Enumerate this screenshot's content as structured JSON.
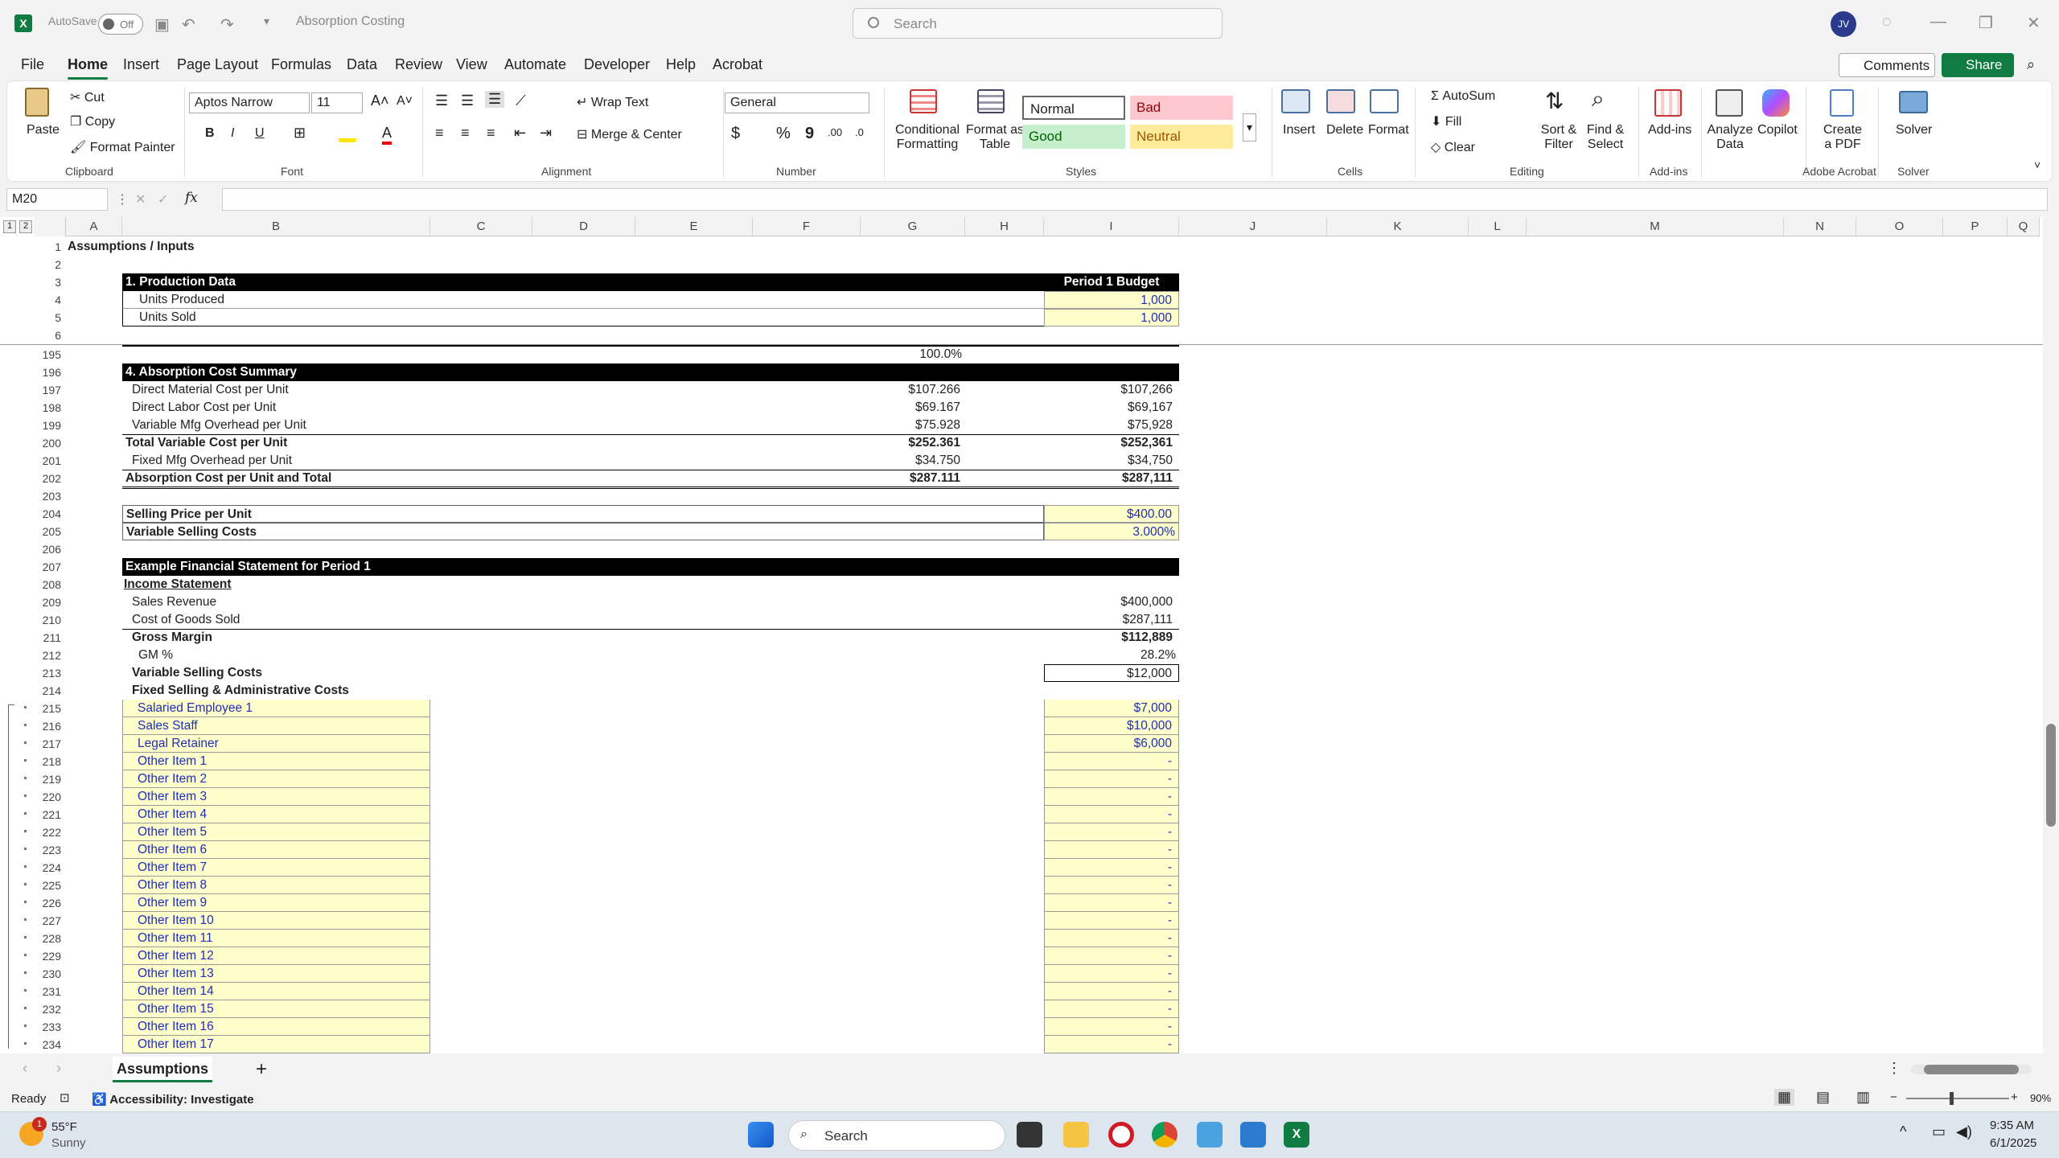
{
  "titlebar": {
    "autosave_label": "AutoSave",
    "autosave_state": "Off",
    "doc_title": "Absorption Costing",
    "search_placeholder": "Search",
    "avatar_initials": "JV"
  },
  "menu": {
    "items": [
      "File",
      "Home",
      "Insert",
      "Page Layout",
      "Formulas",
      "Data",
      "Review",
      "View",
      "Automate",
      "Developer",
      "Help",
      "Acrobat"
    ],
    "active": "Home",
    "comments_label": "Comments",
    "share_label": "Share"
  },
  "ribbon": {
    "clipboard": {
      "paste": "Paste",
      "cut": "Cut",
      "copy": "Copy",
      "format_painter": "Format Painter",
      "group": "Clipboard"
    },
    "font": {
      "name": "Aptos Narrow",
      "size": "11",
      "group": "Font",
      "bold": "B",
      "italic": "I",
      "underline": "U"
    },
    "alignment": {
      "wrap_text": "Wrap Text",
      "merge_center": "Merge & Center",
      "group": "Alignment"
    },
    "number": {
      "format": "General",
      "currency": "$",
      "percent": "%",
      "comma": "9",
      "group": "Number"
    },
    "styles": {
      "conditional": "Conditional",
      "conditional2": "Formatting",
      "format_table": "Format as",
      "format_table2": "Table",
      "normal": "Normal",
      "bad": "Bad",
      "good": "Good",
      "neutral": "Neutral",
      "group": "Styles"
    },
    "cells": {
      "insert": "Insert",
      "delete": "Delete",
      "format": "Format",
      "group": "Cells"
    },
    "editing": {
      "autosum": "AutoSum",
      "fill": "Fill",
      "clear": "Clear",
      "sort1": "Sort &",
      "sort2": "Filter",
      "find1": "Find &",
      "find2": "Select",
      "group": "Editing"
    },
    "addins": {
      "label": "Add-ins",
      "group": "Add-ins"
    },
    "analyze": {
      "l1": "Analyze",
      "l2": "Data"
    },
    "copilot": {
      "label": "Copilot"
    },
    "acrobat": {
      "l1": "Create",
      "l2": "a PDF",
      "group": "Adobe Acrobat"
    },
    "solver": {
      "label": "Solver",
      "group": "Solver"
    }
  },
  "formula_bar": {
    "name_box": "M20",
    "fx": "fx",
    "formula": ""
  },
  "columns": [
    "A",
    "B",
    "C",
    "D",
    "E",
    "F",
    "G",
    "H",
    "I",
    "J",
    "K",
    "L",
    "M",
    "N",
    "O",
    "P",
    "Q"
  ],
  "outline_levels": [
    "1",
    "2"
  ],
  "rows": {
    "r1": "1",
    "r2": "2",
    "r3": "3",
    "r4": "4",
    "r5": "5",
    "r6": "6",
    "r195": "195",
    "r196": "196",
    "r197": "197",
    "r198": "198",
    "r199": "199",
    "r200": "200",
    "r201": "201",
    "r202": "202",
    "r203": "203",
    "r204": "204",
    "r205": "205",
    "r206": "206",
    "r207": "207",
    "r208": "208",
    "r209": "209",
    "r210": "210",
    "r211": "211",
    "r212": "212",
    "r213": "213",
    "r214": "214"
  },
  "sheet": {
    "a1": "Assumptions / Inputs",
    "production_header": "1. Production Data",
    "period_header": "Period 1 Budget",
    "units_produced": "Units Produced",
    "units_produced_val": "1,000",
    "units_sold": "Units Sold",
    "units_sold_val": "1,000",
    "pct_195": "100.0%",
    "summary_header": "4. Absorption Cost Summary",
    "dm_label": "Direct Material Cost per Unit",
    "dm_g": "$107.266",
    "dm_i": "$107,266",
    "dl_label": "Direct Labor Cost per Unit",
    "dl_g": "$69.167",
    "dl_i": "$69,167",
    "vo_label": "Variable Mfg Overhead per Unit",
    "vo_g": "$75.928",
    "vo_i": "$75,928",
    "tv_label": "Total Variable Cost per Unit",
    "tv_g": "$252.361",
    "tv_i": "$252,361",
    "fo_label": "Fixed Mfg Overhead per Unit",
    "fo_g": "$34.750",
    "fo_i": "$34,750",
    "ac_label": "Absorption Cost per Unit and Total",
    "ac_g": "$287.111",
    "ac_i": "$287,111",
    "sp_label": "Selling Price per Unit",
    "sp_val": "$400.00",
    "vs_label": "Variable Selling Costs",
    "vs_val": "3.000%",
    "fs_header": "Example Financial Statement for Period 1",
    "is_header": "Income Statement",
    "sales_label": "Sales Revenue",
    "sales_val": "$400,000",
    "cogs_label": "Cost of Goods Sold",
    "cogs_val": "$287,111",
    "gm_label": "Gross Margin",
    "gm_val": "$112,889",
    "gmp_label": "GM %",
    "gmp_val": "28.2%",
    "vsc_label": "Variable Selling Costs",
    "vsc_val": "$12,000",
    "fsa_label": "Fixed Selling & Administrative Costs"
  },
  "fixed_items": [
    {
      "row": "215",
      "label": "Salaried Employee 1",
      "value": "$7,000"
    },
    {
      "row": "216",
      "label": "Sales Staff",
      "value": "$10,000"
    },
    {
      "row": "217",
      "label": "Legal Retainer",
      "value": "$6,000"
    },
    {
      "row": "218",
      "label": "Other Item 1",
      "value": "-"
    },
    {
      "row": "219",
      "label": "Other Item 2",
      "value": "-"
    },
    {
      "row": "220",
      "label": "Other Item 3",
      "value": "-"
    },
    {
      "row": "221",
      "label": "Other Item 4",
      "value": "-"
    },
    {
      "row": "222",
      "label": "Other Item 5",
      "value": "-"
    },
    {
      "row": "223",
      "label": "Other Item 6",
      "value": "-"
    },
    {
      "row": "224",
      "label": "Other Item 7",
      "value": "-"
    },
    {
      "row": "225",
      "label": "Other Item 8",
      "value": "-"
    },
    {
      "row": "226",
      "label": "Other Item 9",
      "value": "-"
    },
    {
      "row": "227",
      "label": "Other Item 10",
      "value": "-"
    },
    {
      "row": "228",
      "label": "Other Item 11",
      "value": "-"
    },
    {
      "row": "229",
      "label": "Other Item 12",
      "value": "-"
    },
    {
      "row": "230",
      "label": "Other Item 13",
      "value": "-"
    },
    {
      "row": "231",
      "label": "Other Item 14",
      "value": "-"
    },
    {
      "row": "232",
      "label": "Other Item 15",
      "value": "-"
    },
    {
      "row": "233",
      "label": "Other Item 16",
      "value": "-"
    },
    {
      "row": "234",
      "label": "Other Item 17",
      "value": "-"
    }
  ],
  "tabs": {
    "sheet": "Assumptions",
    "add": "+"
  },
  "status": {
    "ready": "Ready",
    "accessibility": "Accessibility: Investigate",
    "zoom": "90%"
  },
  "taskbar": {
    "temp": "55°F",
    "weather": "Sunny",
    "badge": "1",
    "search": "Search",
    "time": "9:35 AM",
    "date": "6/1/2025"
  },
  "colors": {
    "accent": "#107c41",
    "input_blue": "#1f2eb8",
    "input_fill": "#ffffcc"
  }
}
